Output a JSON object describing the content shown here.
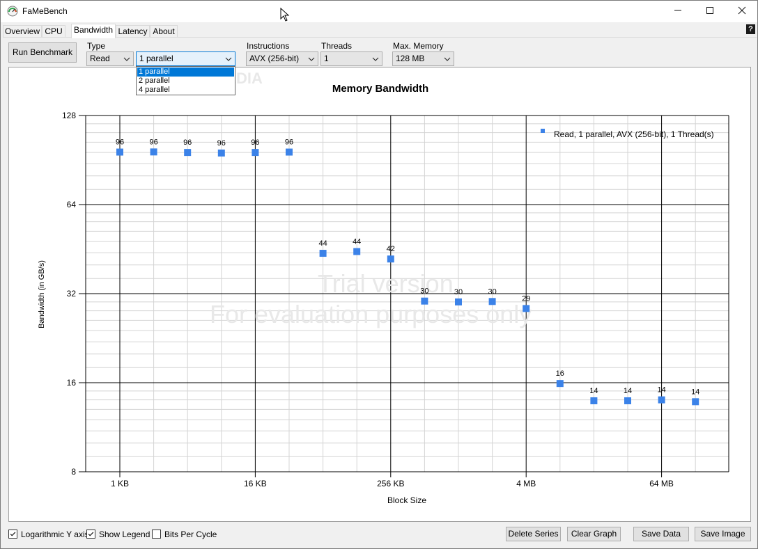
{
  "window": {
    "title": "FaMeBench"
  },
  "tabs": [
    "Overview",
    "CPU",
    "Bandwidth",
    "Latency",
    "About"
  ],
  "active_tab": "Bandwidth",
  "help_label": "?",
  "toolbar": {
    "run_label": "Run Benchmark",
    "type": {
      "label": "Type",
      "value": "Read"
    },
    "parallel": {
      "value": "1 parallel",
      "options": [
        "1 parallel",
        "2 parallel",
        "4 parallel"
      ]
    },
    "instructions": {
      "label": "Instructions",
      "value": "AVX (256-bit)"
    },
    "threads": {
      "label": "Threads",
      "value": "1"
    },
    "max_memory": {
      "label": "Max. Memory",
      "value": "128 MB"
    }
  },
  "watermark": {
    "line1": "Trial version",
    "line2": "For evaluation purposes only",
    "logo_text": "SOFTPEDIA"
  },
  "chart_data": {
    "type": "scatter",
    "title": "Memory Bandwidth",
    "xlabel": "Block Size",
    "ylabel": "Bandwidth (in GB/s)",
    "y_scale": "log2",
    "ylim": [
      8,
      128
    ],
    "y_ticks": [
      8,
      16,
      32,
      64,
      128
    ],
    "x_scale": "log2",
    "x_ticks": [
      "1 KB",
      "16 KB",
      "256 KB",
      "4 MB",
      "64 MB"
    ],
    "grid": true,
    "legend": "top-right",
    "series": [
      {
        "name": "Read, 1 parallel, AVX (256-bit), 1 Thread(s)",
        "color": "#3b82e8",
        "x": [
          "1 KB",
          "2 KB",
          "4 KB",
          "8 KB",
          "16 KB",
          "32 KB",
          "64 KB",
          "128 KB",
          "256 KB",
          "512 KB",
          "1 MB",
          "2 MB",
          "4 MB",
          "8 MB",
          "16 MB",
          "32 MB",
          "64 MB",
          "128 MB"
        ],
        "values": [
          96.3,
          96.4,
          96.0,
          95.6,
          96.0,
          96.3,
          43.8,
          44.4,
          41.9,
          30.2,
          30.0,
          30.1,
          28.5,
          15.9,
          13.9,
          13.9,
          14.0,
          13.8
        ],
        "labels": [
          "96",
          "96",
          "96",
          "96",
          "96",
          "96",
          "44",
          "44",
          "42",
          "30",
          "30",
          "30",
          "29",
          "16",
          "14",
          "14",
          "14",
          "14"
        ]
      }
    ]
  },
  "options": {
    "log_y_label": "Logarithmic Y axis",
    "log_y_checked": true,
    "legend_label": "Show Legend",
    "legend_checked": true,
    "bits_label": "Bits Per Cycle",
    "bits_checked": false
  },
  "actions": {
    "delete_series": "Delete Series",
    "clear_graph": "Clear Graph",
    "save_data": "Save Data",
    "save_image": "Save Image"
  }
}
